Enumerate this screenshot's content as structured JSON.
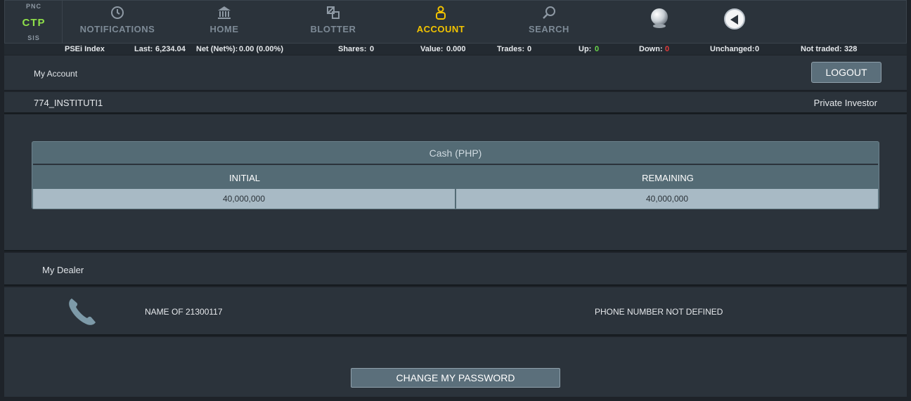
{
  "brand": {
    "top": "PNC",
    "main": "CTP",
    "bottom": "SIS"
  },
  "nav": [
    {
      "label": "NOTIFICATIONS",
      "icon": "clock-icon",
      "active": false
    },
    {
      "label": "HOME",
      "icon": "bank-icon",
      "active": false
    },
    {
      "label": "BLOTTER",
      "icon": "blotter-icon",
      "active": false
    },
    {
      "label": "ACCOUNT",
      "icon": "user-icon",
      "active": true
    },
    {
      "label": "SEARCH",
      "icon": "search-icon",
      "active": false
    }
  ],
  "ticker": {
    "index": "PSEi Index",
    "last_label": "Last:",
    "last": "6,234.04",
    "net_label": "Net (Net%):",
    "net": "0.00 (0.00%)",
    "shares_label": "Shares:",
    "shares": "0",
    "value_label": "Value:",
    "value": "0.000",
    "trades_label": "Trades:",
    "trades": "0",
    "up_label": "Up:",
    "up": "0",
    "down_label": "Down:",
    "down": "0",
    "unchanged_label": "Unchanged:",
    "unchanged": "0",
    "not_traded_label": "Not traded:",
    "not_traded": "328"
  },
  "account": {
    "title": "My Account",
    "logout": "LOGOUT",
    "id": "774_INSTITUTI1",
    "type": "Private Investor"
  },
  "cash": {
    "title": "Cash (PHP)",
    "initial_label": "INITIAL",
    "remaining_label": "REMAINING",
    "initial": "40,000,000",
    "remaining": "40,000,000"
  },
  "dealer": {
    "title": "My Dealer",
    "name": "NAME OF 21300117",
    "phone": "PHONE NUMBER NOT DEFINED"
  },
  "change_password": "CHANGE MY PASSWORD",
  "colors": {
    "accent": "#f2c300",
    "brand": "#8fe04a",
    "up": "#6ad64a",
    "down": "#e53a3a"
  }
}
